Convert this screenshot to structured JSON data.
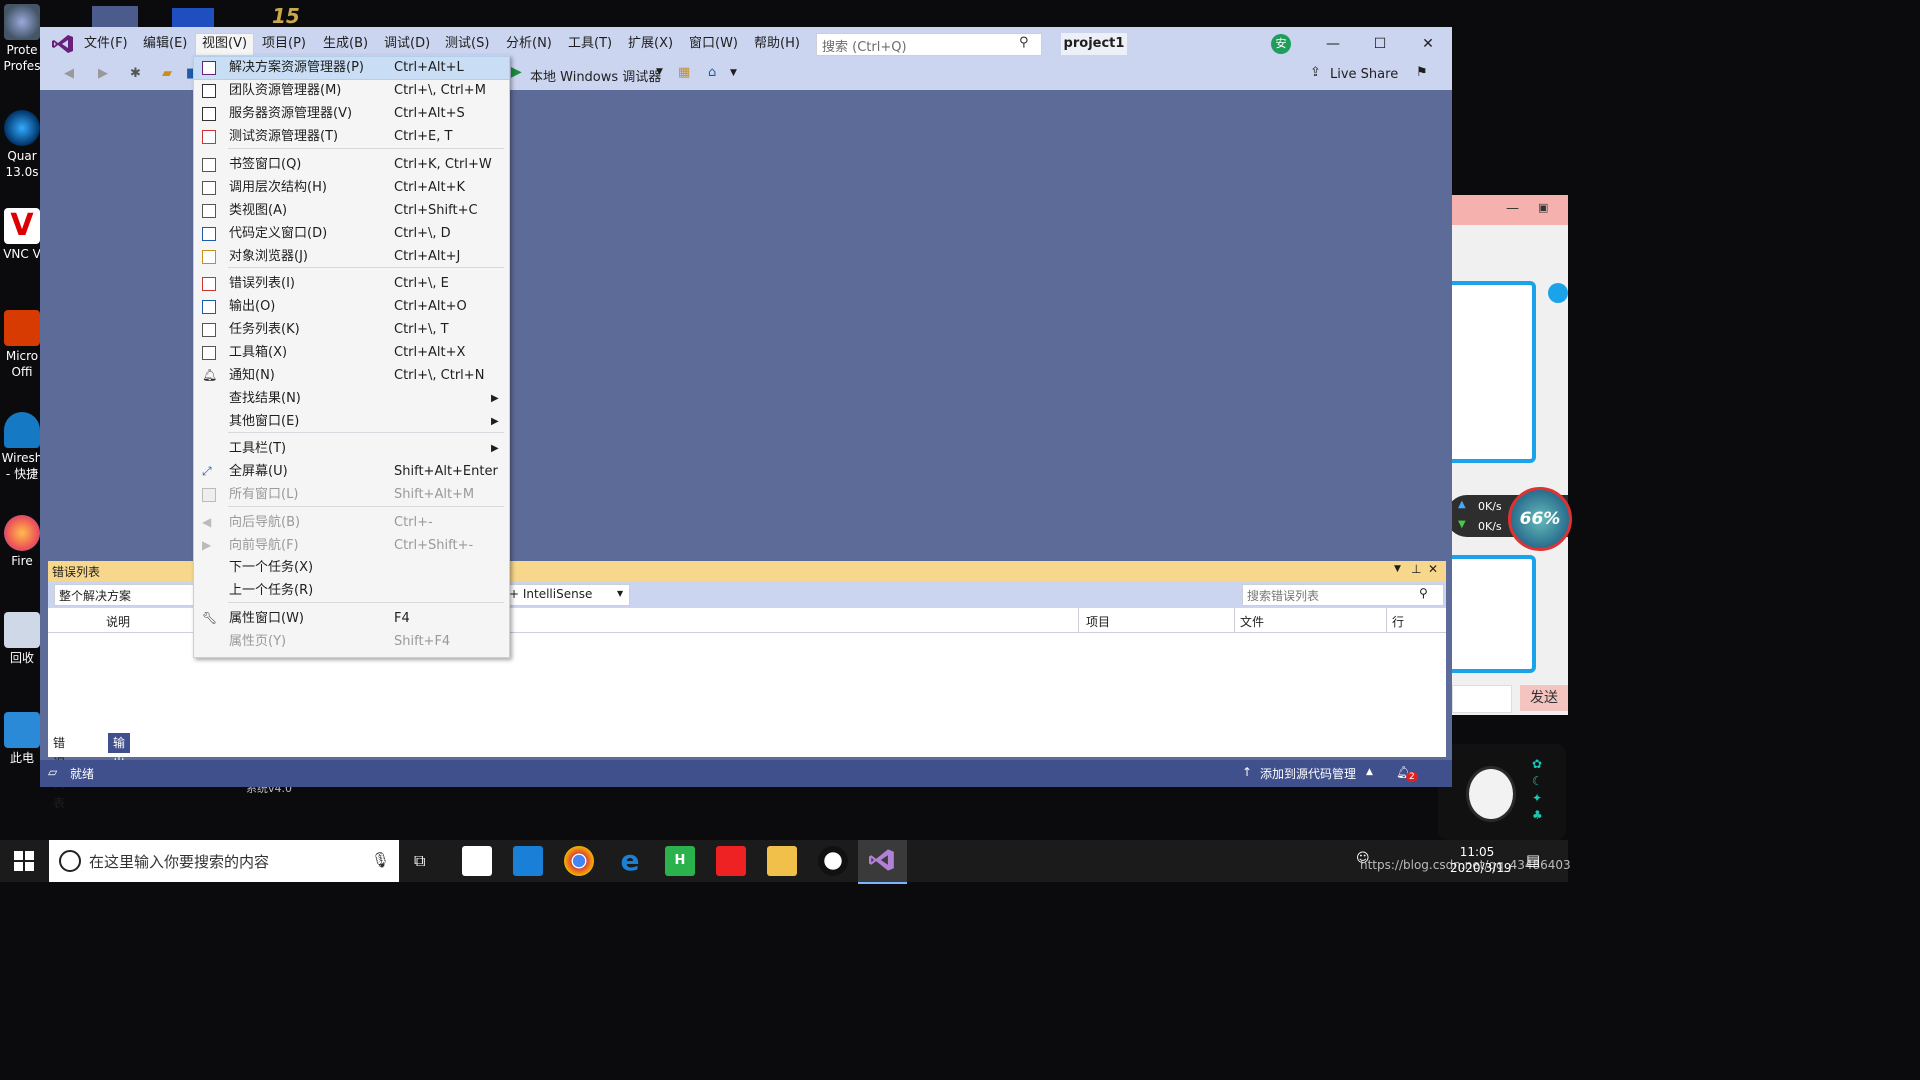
{
  "desktop": {
    "icons": [
      {
        "line1": "Prote",
        "line2": "Profes"
      },
      {
        "line1": "Quar",
        "line2": "13.0s"
      },
      {
        "line1": "VNC V",
        "line2": ""
      },
      {
        "line1": "Micro",
        "line2": "Offi"
      },
      {
        "line1": "Wiresh",
        "line2": "- 快捷"
      },
      {
        "line1": "Fire",
        "line2": ""
      },
      {
        "line1": "回收",
        "line2": ""
      },
      {
        "line1": "此电",
        "line2": ""
      }
    ],
    "bottom_fragment": "系统v4.0",
    "top_fragment": "15"
  },
  "vs": {
    "menubar": [
      "文件(F)",
      "编辑(E)",
      "视图(V)",
      "项目(P)",
      "生成(B)",
      "调试(D)",
      "测试(S)",
      "分析(N)",
      "工具(T)",
      "扩展(X)",
      "窗口(W)",
      "帮助(H)"
    ],
    "search_placeholder": "搜索 (Ctrl+Q)",
    "project_name": "project1",
    "user_initial": "安",
    "debugger_label": "本地 Windows 调试器",
    "live_share": "Live Share",
    "status_text": "就绪",
    "source_control": "添加到源代码管理",
    "notification_count": "2"
  },
  "view_menu": {
    "items": [
      {
        "label": "解决方案资源管理器(P)",
        "shortcut": "Ctrl+Alt+L",
        "icon": "solution-explorer-icon",
        "selected": true
      },
      {
        "label": "团队资源管理器(M)",
        "shortcut": "Ctrl+\\, Ctrl+M",
        "icon": "team-explorer-icon"
      },
      {
        "label": "服务器资源管理器(V)",
        "shortcut": "Ctrl+Alt+S",
        "icon": "server-explorer-icon"
      },
      {
        "label": "测试资源管理器(T)",
        "shortcut": "Ctrl+E, T",
        "icon": "test-explorer-icon"
      },
      {
        "label": "书签窗口(Q)",
        "shortcut": "Ctrl+K, Ctrl+W",
        "icon": "bookmark-icon"
      },
      {
        "label": "调用层次结构(H)",
        "shortcut": "Ctrl+Alt+K",
        "icon": "call-hierarchy-icon"
      },
      {
        "label": "类视图(A)",
        "shortcut": "Ctrl+Shift+C",
        "icon": "class-view-icon"
      },
      {
        "label": "代码定义窗口(D)",
        "shortcut": "Ctrl+\\, D",
        "icon": "code-definition-icon"
      },
      {
        "label": "对象浏览器(J)",
        "shortcut": "Ctrl+Alt+J",
        "icon": "object-browser-icon"
      },
      {
        "label": "错误列表(I)",
        "shortcut": "Ctrl+\\, E",
        "icon": "error-list-icon"
      },
      {
        "label": "输出(O)",
        "shortcut": "Ctrl+Alt+O",
        "icon": "output-icon"
      },
      {
        "label": "任务列表(K)",
        "shortcut": "Ctrl+\\, T",
        "icon": "task-list-icon"
      },
      {
        "label": "工具箱(X)",
        "shortcut": "Ctrl+Alt+X",
        "icon": "toolbox-icon"
      },
      {
        "label": "通知(N)",
        "shortcut": "Ctrl+\\, Ctrl+N",
        "icon": "bell-icon"
      },
      {
        "label": "查找结果(N)",
        "shortcut": "",
        "submenu": true
      },
      {
        "label": "其他窗口(E)",
        "shortcut": "",
        "submenu": true
      },
      {
        "label": "工具栏(T)",
        "shortcut": "",
        "submenu": true
      },
      {
        "label": "全屏幕(U)",
        "shortcut": "Shift+Alt+Enter",
        "icon": "fullscreen-icon"
      },
      {
        "label": "所有窗口(L)",
        "shortcut": "Shift+Alt+M",
        "icon": "all-windows-icon",
        "disabled": true
      },
      {
        "label": "向后导航(B)",
        "shortcut": "Ctrl+-",
        "icon": "navigate-back-icon",
        "disabled": true
      },
      {
        "label": "向前导航(F)",
        "shortcut": "Ctrl+Shift+-",
        "icon": "navigate-forward-icon",
        "disabled": true
      },
      {
        "label": "下一个任务(X)",
        "shortcut": ""
      },
      {
        "label": "上一个任务(R)",
        "shortcut": ""
      },
      {
        "label": "属性窗口(W)",
        "shortcut": "F4",
        "icon": "wrench-icon"
      },
      {
        "label": "属性页(Y)",
        "shortcut": "Shift+F4",
        "disabled": true
      }
    ]
  },
  "error_list": {
    "title": "错误列表",
    "scope": "整个解决方案",
    "build_filter": "+ IntelliSense",
    "search_placeholder": "搜索错误列表",
    "columns": [
      "说明",
      "项目",
      "文件",
      "行"
    ],
    "tabs": [
      "错误列表",
      "输出"
    ]
  },
  "right_side": {
    "send_button": "发送",
    "net_up": "0K/s",
    "net_down": "0K/s",
    "percent": "66%"
  },
  "taskbar": {
    "search_placeholder": "在这里输入你要搜索的内容",
    "time": "11:05",
    "date": "2020/3/19",
    "watermark": "https://blog.csdn.net/qq_43486403"
  }
}
